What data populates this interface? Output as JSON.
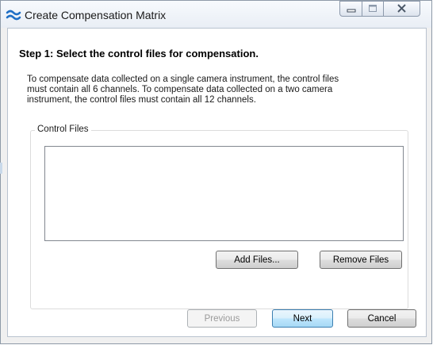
{
  "window": {
    "title": "Create Compensation Matrix",
    "app_icon": "waves-icon",
    "controls": [
      "minimize-icon",
      "maximize-icon",
      "close-icon"
    ]
  },
  "step": {
    "title": "Step 1:  Select the control files for compensation."
  },
  "description": {
    "line1": "To compensate data collected on a single camera instrument, the control files",
    "line2": "must contain all 6 channels.  To compensate data collected on a two camera",
    "line3": "instrument, the control files must contain all 12 channels."
  },
  "control_files": {
    "label": "Control Files",
    "add_label": "Add Files...",
    "remove_label": "Remove Files"
  },
  "footer": {
    "previous_label": "Previous",
    "next_label": "Next",
    "cancel_label": "Cancel"
  },
  "colors": {
    "accent": "#1f6fc5",
    "window_bg": "#f0f0f0",
    "border": "#8e9aa8"
  }
}
